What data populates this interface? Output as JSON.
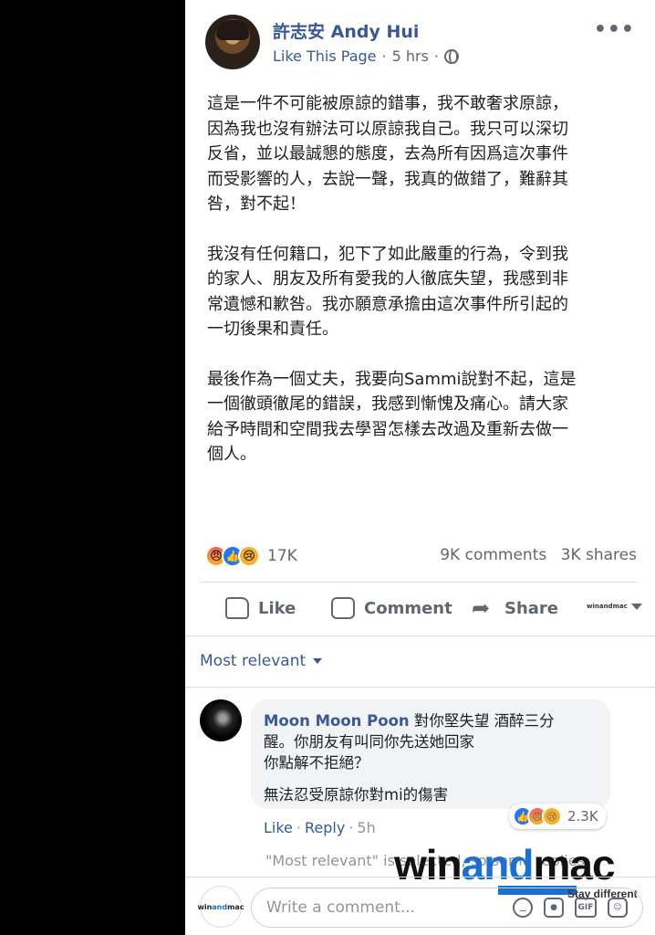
{
  "post": {
    "page_name": "許志安 Andy Hui",
    "like_page": "Like This Page",
    "time": "5 hrs",
    "separator": "·",
    "more": "•••",
    "paragraphs": [
      "這是一件不可能被原諒的錯事，我不敢奢求原諒，\n因為我也沒有辦法可以原諒我自己。我只可以深切\n反省，並以最誠懇的態度，去為所有因爲這次事件\n而受影響的人，去說一聲，我真的做錯了，難辭其\n咎，對不起！",
      "我沒有任何籍口，犯下了如此嚴重的行為，令到我\n的家人、朋友及所有愛我的人徹底失望，我感到非\n常遺憾和歉咎。我亦願意承擔由這次事件所引起的\n一切後果和責任。",
      "最後作為一個丈夫，我要向Sammi說對不起，這是\n一個徹頭徹尾的錯誤，我感到慚愧及痛心。請大家\n給予時間和空間我去學習怎樣去改過及重新去做一\n個人。"
    ],
    "reaction_count": "17K",
    "comments_count": "9K comments",
    "shares_count": "3K shares"
  },
  "actions": {
    "like": "Like",
    "comment": "Comment",
    "share": "Share",
    "page_logo": "winandmac"
  },
  "sort": {
    "label": "Most relevant"
  },
  "comment": {
    "author": "Moon Moon Poon",
    "text_line1": " 對你堅失望 酒醉三分\n醒。你朋友有叫同你先送她回家\n你點解不拒絕？",
    "text_line2": "無法忍受原諒你對mi的傷害",
    "reaction_count": "2.3K",
    "like": "Like",
    "reply": "Reply",
    "time": "5h"
  },
  "note": "\"Most relevant\" is selected, so some replies",
  "watermark": {
    "win": "win",
    "and": "and",
    "mac": "mac",
    "tagline": "Stay different"
  },
  "composer": {
    "placeholder": "Write a comment...",
    "avatar_text_win": "win",
    "avatar_text_and": "and",
    "avatar_text_mac": "mac",
    "gif_label": "GIF"
  },
  "colors": {
    "link": "#385898",
    "text": "#1c1e21",
    "muted": "#616770",
    "brand_blue": "#1a6fd1"
  }
}
